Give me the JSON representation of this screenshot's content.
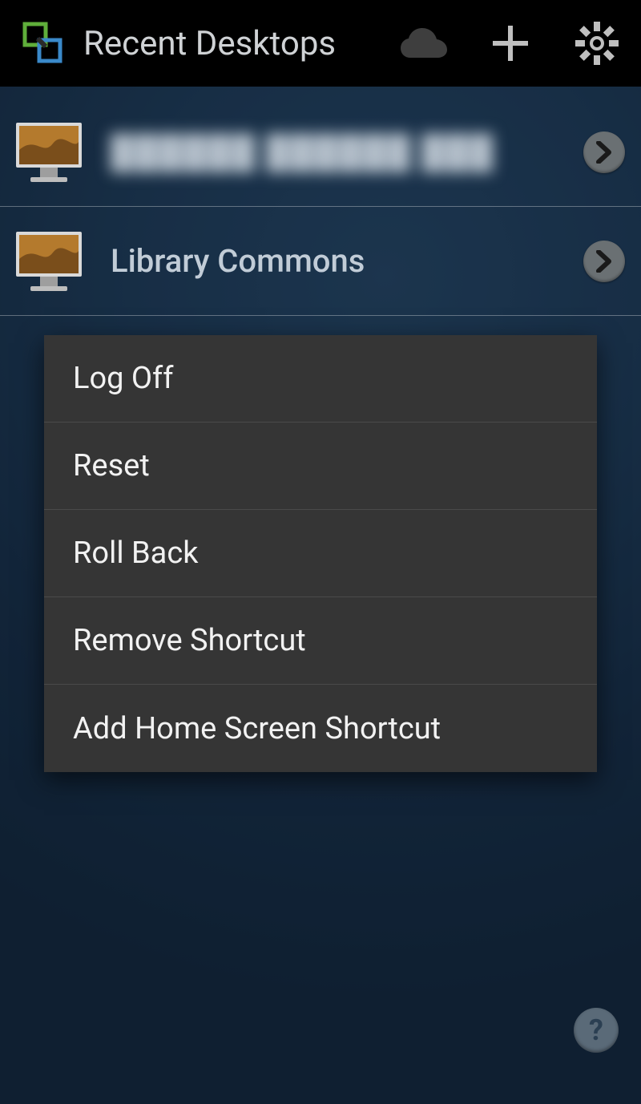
{
  "header": {
    "title": "Recent Desktops"
  },
  "desktops": [
    {
      "label": "██████ ██████ ███",
      "blurred": true
    },
    {
      "label": "Library Commons",
      "blurred": false
    }
  ],
  "context_menu": {
    "items": [
      {
        "label": "Log Off"
      },
      {
        "label": "Reset"
      },
      {
        "label": "Roll Back"
      },
      {
        "label": "Remove Shortcut"
      },
      {
        "label": "Add Home Screen Shortcut"
      }
    ]
  },
  "help_glyph": "?"
}
